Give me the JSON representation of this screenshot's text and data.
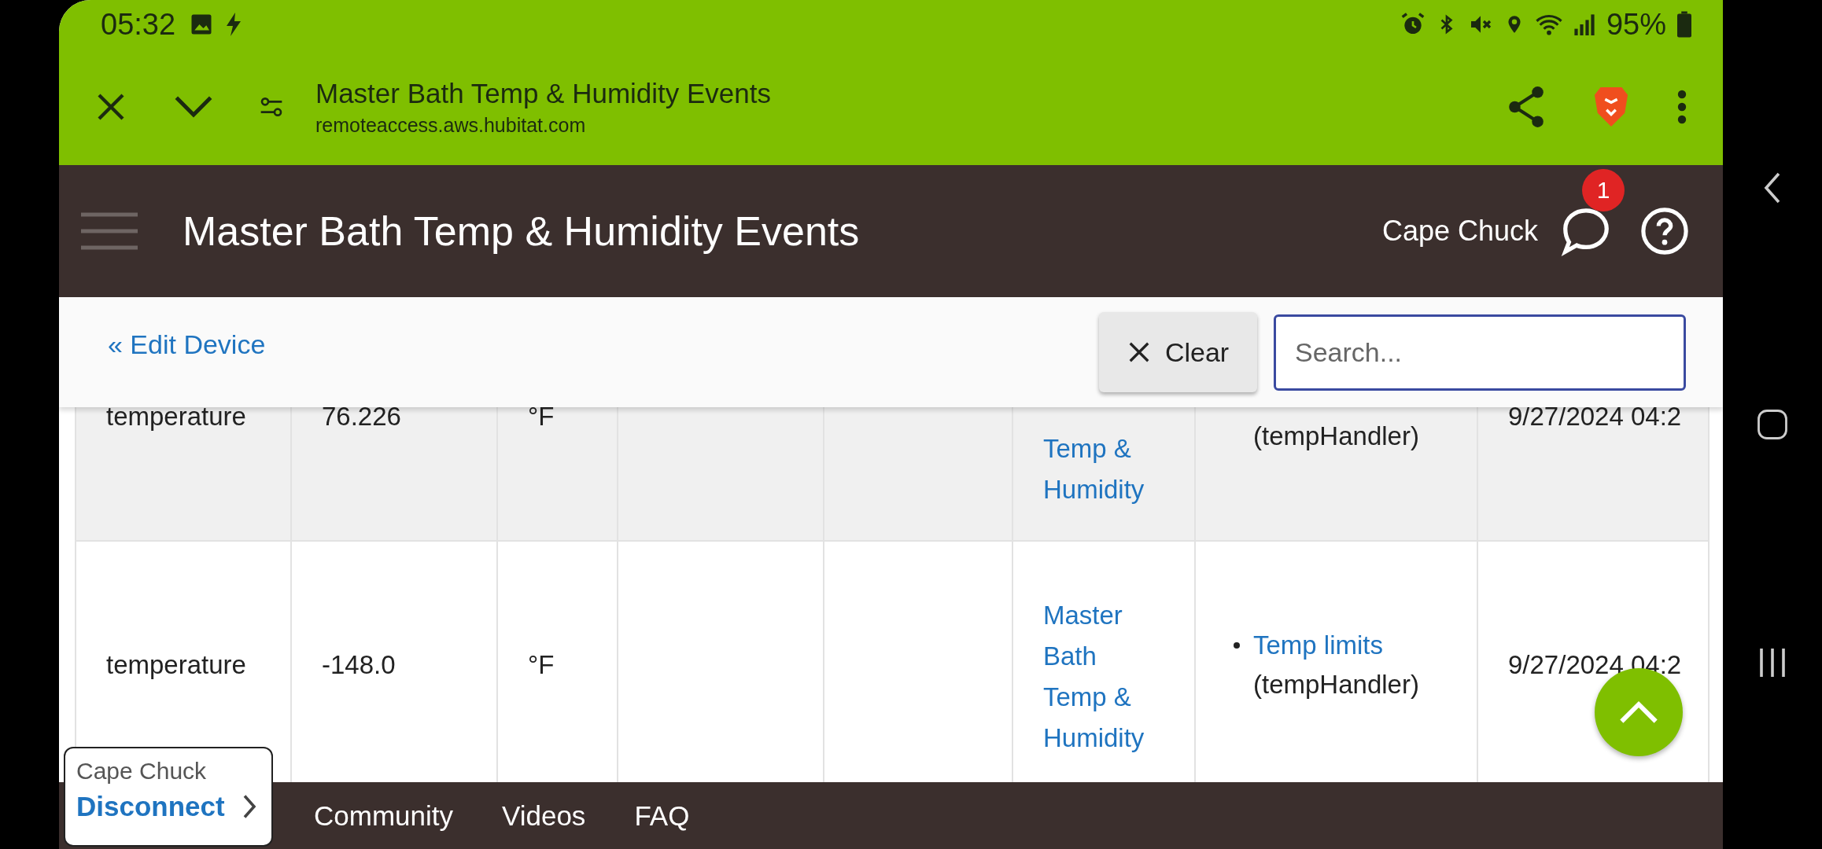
{
  "status_bar": {
    "time": "05:32",
    "battery": "95%"
  },
  "browser_bar": {
    "title": "Master Bath Temp & Humidity Events",
    "url": "remoteaccess.aws.hubitat.com"
  },
  "header": {
    "title": "Master Bath Temp & Humidity Events",
    "user": "Cape Chuck",
    "notification_count": "1"
  },
  "toolbar": {
    "back_link": "« Edit Device",
    "clear_button": "Clear",
    "search": {
      "placeholder": "Search..."
    }
  },
  "table": {
    "rows": [
      {
        "name": "temperature",
        "value": "76.226",
        "unit": "°F",
        "device": "Temp & Humidity",
        "trigger_handler": "(tempHandler)",
        "date": "9/27/2024 04:2"
      },
      {
        "name": "temperature",
        "value": "-148.0",
        "unit": "°F",
        "device": "Master Bath Temp & Humidity",
        "trigger_link": "Temp limits",
        "trigger_handler": "(tempHandler)",
        "date": "9/27/2024 04:2"
      }
    ]
  },
  "bottom_nav": [
    "Community",
    "Videos",
    "FAQ"
  ],
  "session_popup": {
    "hub": "Cape Chuck",
    "action": "Disconnect"
  }
}
